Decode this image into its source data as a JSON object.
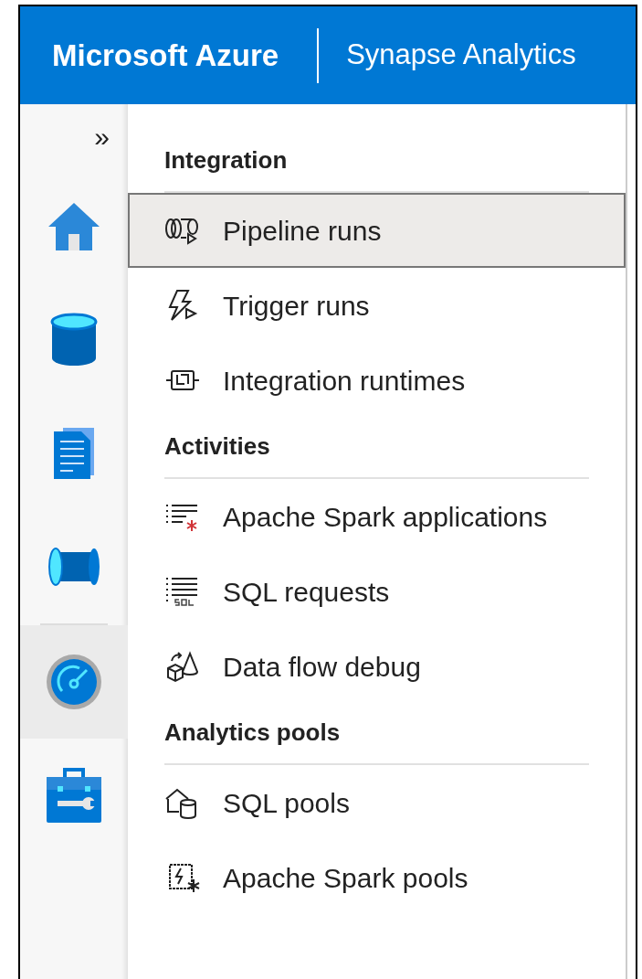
{
  "header": {
    "brand": "Microsoft Azure",
    "product": "Synapse Analytics"
  },
  "rail": {
    "expand": "»",
    "items": [
      {
        "selected": false
      },
      {
        "selected": false
      },
      {
        "selected": false
      },
      {
        "selected": false
      },
      {
        "selected": true
      },
      {
        "selected": false
      }
    ]
  },
  "menu": [
    {
      "heading": "Integration",
      "items": [
        {
          "label": "Pipeline runs",
          "selected": true
        },
        {
          "label": "Trigger runs",
          "selected": false
        },
        {
          "label": "Integration runtimes",
          "selected": false
        }
      ]
    },
    {
      "heading": "Activities",
      "items": [
        {
          "label": "Apache Spark applications",
          "selected": false
        },
        {
          "label": "SQL requests",
          "selected": false
        },
        {
          "label": "Data flow debug",
          "selected": false
        }
      ]
    },
    {
      "heading": "Analytics pools",
      "items": [
        {
          "label": "SQL pools",
          "selected": false
        },
        {
          "label": "Apache Spark pools",
          "selected": false
        }
      ]
    }
  ]
}
